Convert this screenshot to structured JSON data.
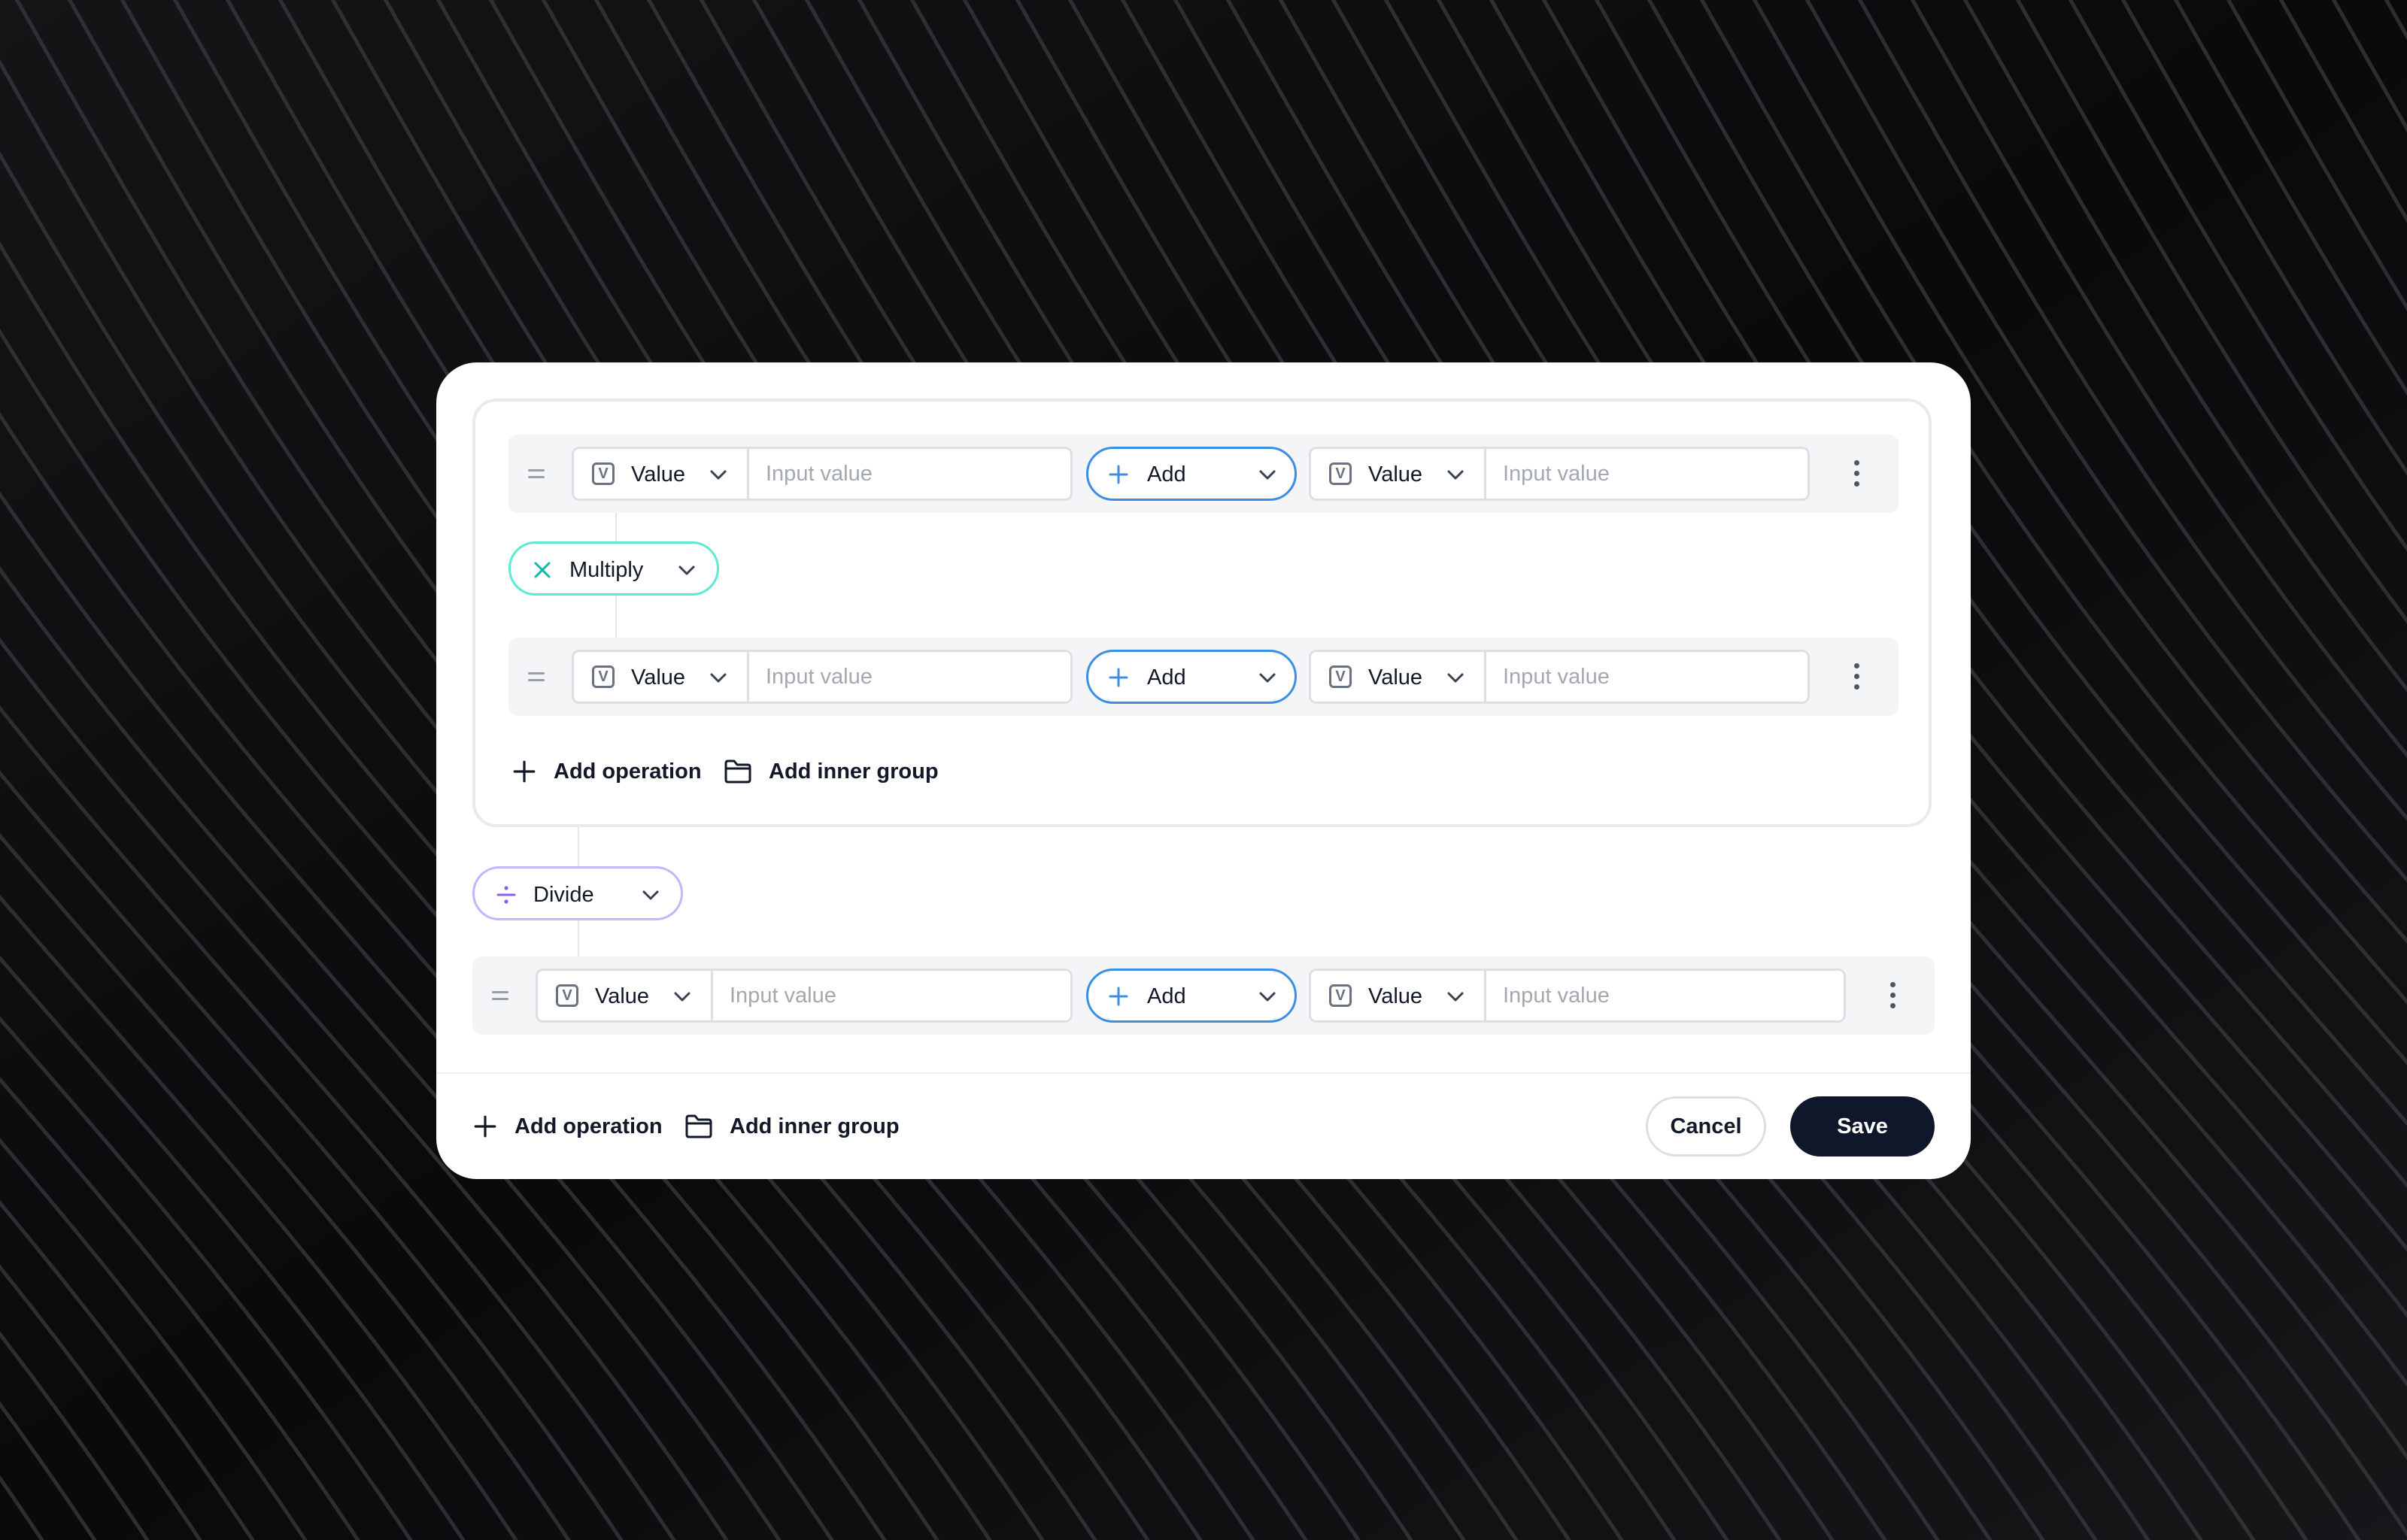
{
  "colors": {
    "background": "#0b0b0c",
    "add_accent": "#3b8fe3",
    "multiply_accent": "#2dd4bf",
    "divide_accent": "#a78bfa",
    "save_bg": "#0f172a"
  },
  "group": {
    "rows": [
      {
        "left_type": "Value",
        "left_placeholder": "Input value",
        "operator": "Add",
        "right_type": "Value",
        "right_placeholder": "Input value"
      },
      {
        "left_type": "Value",
        "left_placeholder": "Input value",
        "operator": "Add",
        "right_type": "Value",
        "right_placeholder": "Input value"
      }
    ],
    "connector": "Multiply",
    "add_operation": "Add operation",
    "add_inner_group": "Add inner group"
  },
  "outer_connector": "Divide",
  "outer_row": {
    "left_type": "Value",
    "left_placeholder": "Input value",
    "operator": "Add",
    "right_type": "Value",
    "right_placeholder": "Input value"
  },
  "footer": {
    "add_operation": "Add operation",
    "add_inner_group": "Add inner group",
    "cancel": "Cancel",
    "save": "Save"
  }
}
